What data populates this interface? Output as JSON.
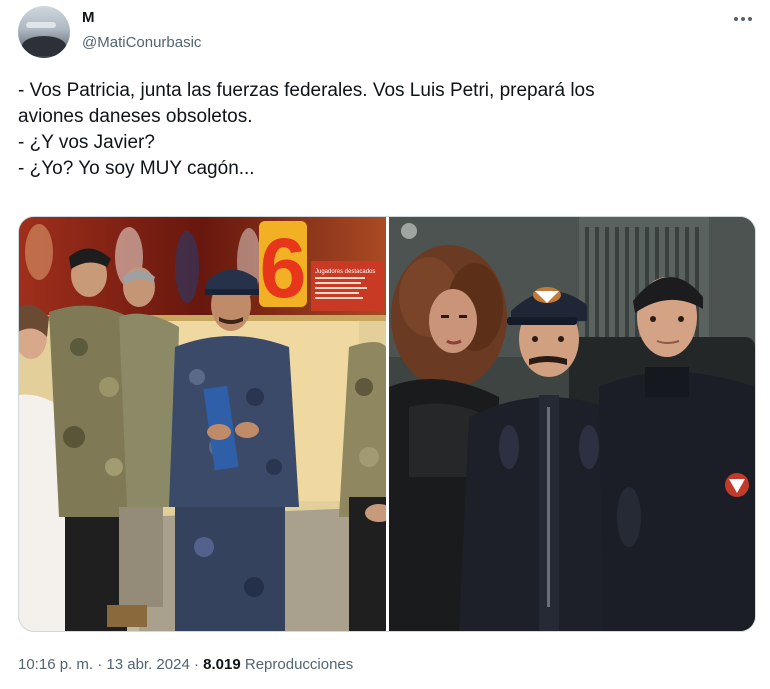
{
  "user": {
    "display_name": "M",
    "handle": "@MatiConurbasic"
  },
  "tweet": {
    "lines": [
      "- Vos Patricia, junta las fuerzas federales. Vos Luis Petri, prepará los",
      "aviones daneses obsoletos.",
      "- ¿Y vos Javier?",
      "- ¿Yo? Yo soy MUY cagón..."
    ]
  },
  "media": {
    "left_photo": {
      "sign_number": "6",
      "sign_caption": "Jugadores destacados"
    }
  },
  "meta": {
    "time": "10:16 p. m.",
    "separator": "·",
    "date": "13 abr. 2024",
    "views_count": "8.019",
    "views_label": "Reproducciones"
  },
  "colors": {
    "text": "#0f1419",
    "secondary": "#536471",
    "border": "#cfd9de"
  },
  "icons": {
    "more": "more-horizontal-icon"
  }
}
